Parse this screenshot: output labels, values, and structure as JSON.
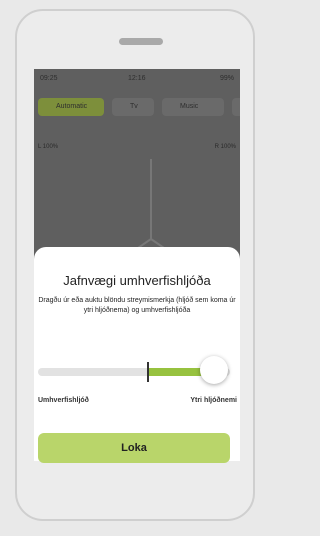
{
  "background_app": {
    "status_left": "09:25",
    "status_center": "12:16",
    "status_right": "99%",
    "tabs": [
      "Automatic",
      "Tv",
      "Music",
      ""
    ],
    "level_left": "L 100%",
    "level_right": "R 100%"
  },
  "sheet": {
    "title": "Jafnvægi umhverfishljóða",
    "description": "Dragðu úr eða auktu blöndu streymismerkja (hljóð sem koma úr ytri hljóðnema) og umhverfishljóða",
    "slider": {
      "left_label": "Umhverfishljóð",
      "right_label": "Ytri hljóðnemi",
      "value": 1.0
    },
    "close_button": "Loka"
  },
  "colors": {
    "accent": "#97c23f",
    "button": "#b9d56a"
  }
}
